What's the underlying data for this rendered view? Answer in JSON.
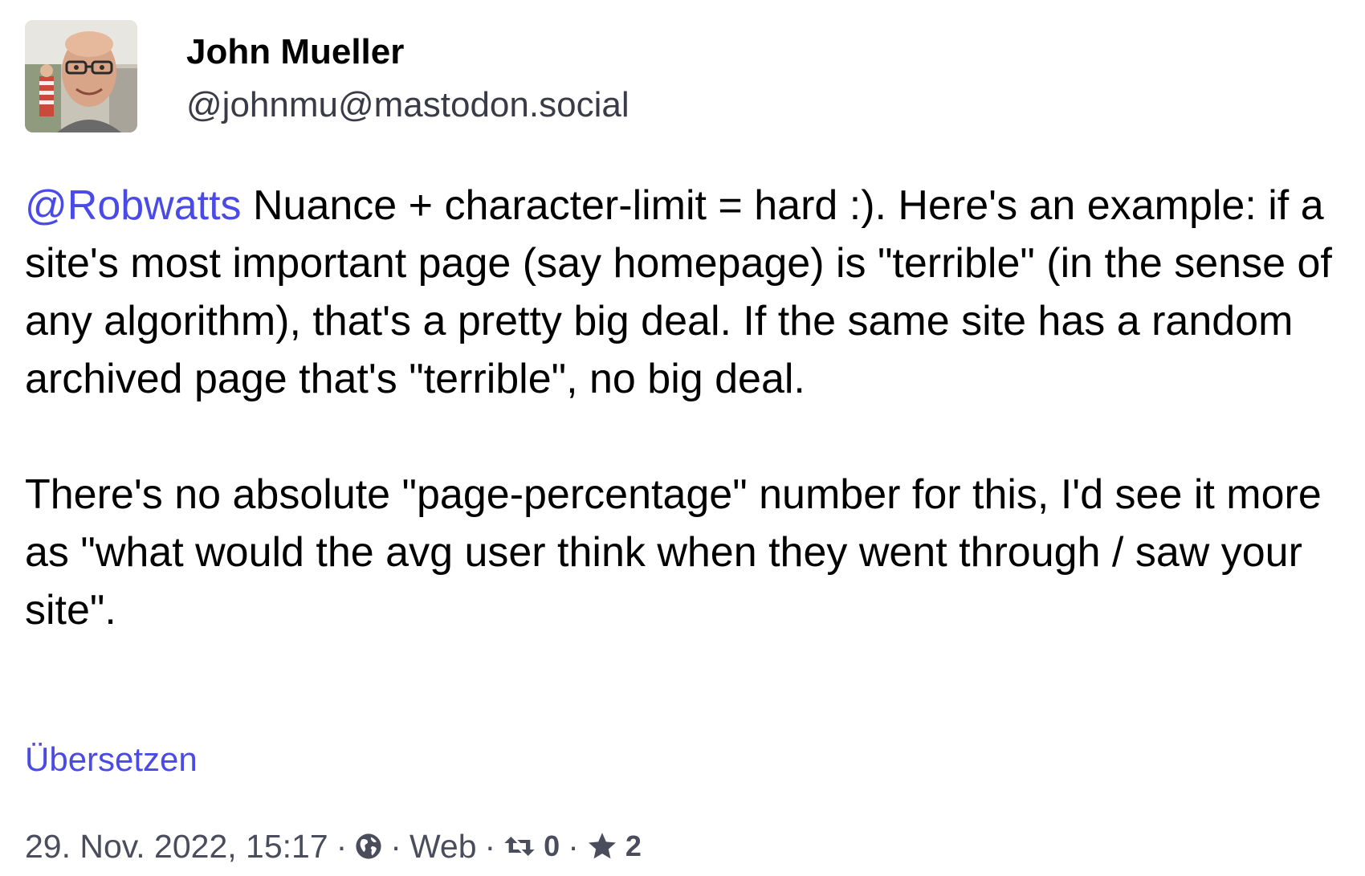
{
  "author": {
    "display_name": "John Mueller",
    "handle": "@johnmu@mastodon.social"
  },
  "post": {
    "mention": "@Robwatts",
    "paragraph_1_text": " Nuance + character-limit = hard :). Here's an example: if a site's most important page (say homepage) is \"terrible\" (in the sense of any algorithm), that's a pretty big deal. If the same site has a random archived page that's \"terrible\", no big deal.",
    "paragraph_2_text": "There's no absolute \"page-percentage\" number for this, I'd see it more as \"what would the avg user think when they went through / saw your site\"."
  },
  "translate_label": "Übersetzen",
  "meta": {
    "timestamp": "29. Nov. 2022, 15:17",
    "separator": "·",
    "visibility_icon": "globe-icon",
    "app": "Web",
    "boost_icon": "boost-icon",
    "boost_count": "0",
    "favourite_icon": "star-icon",
    "favourite_count": "2"
  },
  "colors": {
    "link": "#4a4ae6",
    "meta_text": "#4b4d5d",
    "handle_text": "#3a3b46"
  }
}
